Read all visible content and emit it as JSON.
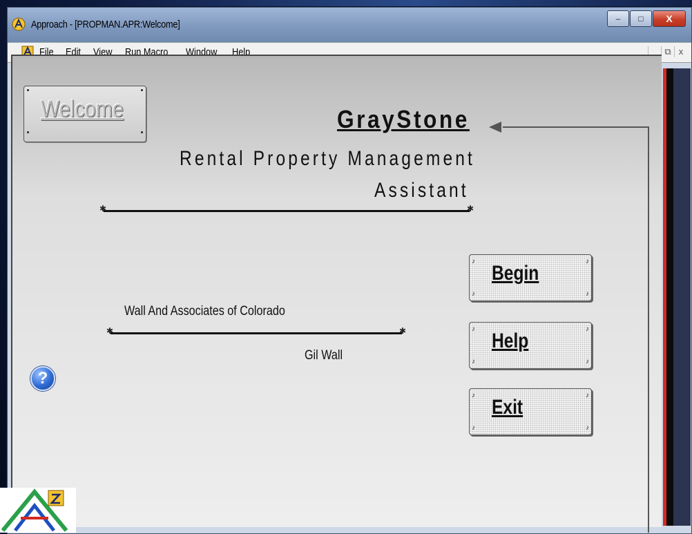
{
  "window": {
    "title": "Approach - [PROPMAN.APR:Welcome]",
    "controls": {
      "minimize": "–",
      "maximize": "□",
      "close": "X"
    }
  },
  "menubar": {
    "items": [
      "File",
      "Edit",
      "View",
      "Run Macro",
      "Window",
      "Help"
    ],
    "mdi_controls": {
      "minimize": "_",
      "restore": "⧉",
      "close": "x"
    }
  },
  "form": {
    "welcome_label": "Welcome",
    "heading": "GrayStone",
    "subtitle_line1": "Rental Property Management",
    "subtitle_line2": "Assistant",
    "company": "Wall And Associates of Colorado",
    "author": "Gil Wall",
    "help_glyph": "?",
    "buttons": {
      "begin": "Begin",
      "help": "Help",
      "exit": "Exit"
    }
  },
  "colors": {
    "accent_red": "#d42a20",
    "titlebar": "#7d97bd",
    "form_bg": "#dedede"
  }
}
